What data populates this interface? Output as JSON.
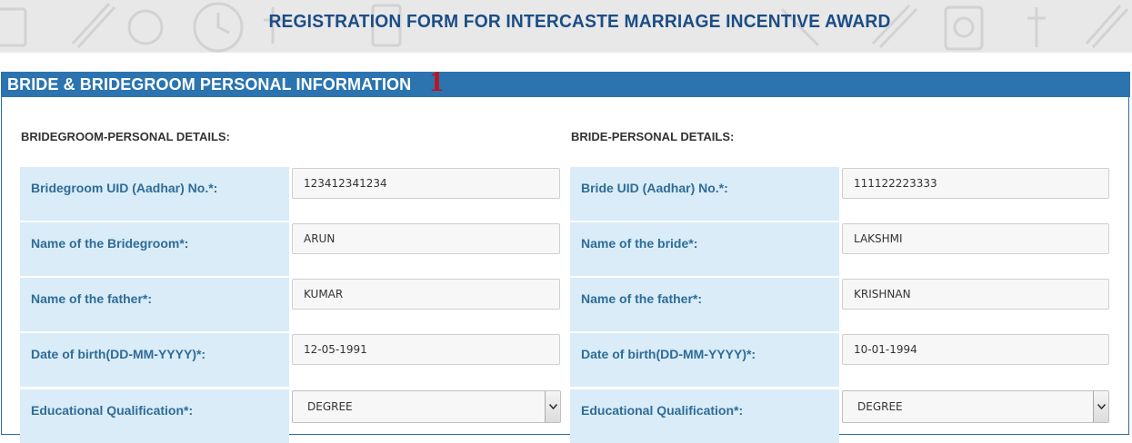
{
  "banner": {
    "title": "REGISTRATION FORM FOR INTERCASTE MARRIAGE INCENTIVE AWARD"
  },
  "panel": {
    "title": "BRIDE & BRIDEGROOM PERSONAL INFORMATION",
    "marker": "1"
  },
  "groom": {
    "section_title": "BRIDEGROOM-PERSONAL DETAILS:",
    "uid_label": "Bridegroom UID (Aadhar) No.*:",
    "uid_value": "123412341234",
    "name_label": "Name of the Bridegroom*:",
    "name_value": "ARUN",
    "father_label": "Name of the father*:",
    "father_value": "KUMAR",
    "dob_label": "Date of birth(DD-MM-YYYY)*:",
    "dob_value": "12-05-1991",
    "edu_label": "Educational Qualification*:",
    "edu_value": "DEGREE"
  },
  "bride": {
    "section_title": "BRIDE-PERSONAL DETAILS:",
    "uid_label": "Bride UID (Aadhar) No.*:",
    "uid_value": "111122223333",
    "name_label": "Name of the bride*:",
    "name_value": "LAKSHMI",
    "father_label": "Name of the father*:",
    "father_value": "KRISHNAN",
    "dob_label": "Date of birth(DD-MM-YYYY)*:",
    "dob_value": "10-01-1994",
    "edu_label": "Educational Qualification*:",
    "edu_value": "DEGREE"
  },
  "colors": {
    "banner_title": "#1b4d86",
    "panel_header": "#2b74b0",
    "label_bg": "#d9ecf7",
    "label_text": "#2f6c97",
    "marker": "#c0141b"
  }
}
